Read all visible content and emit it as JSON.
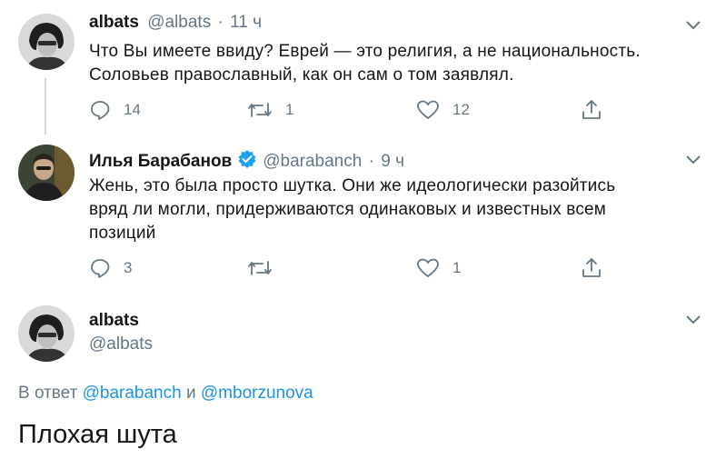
{
  "tweet1": {
    "author_name": "albats",
    "author_handle": "@albats",
    "separator": "·",
    "time": "11 ч",
    "text_line1": "Что Вы имеете ввиду? Еврей — это религия, а не национальность.",
    "text_line2": "Соловьев православный, как он сам о том заявлял.",
    "replies": "14",
    "retweets": "1",
    "likes": "12"
  },
  "tweet2": {
    "author_name": "Илья Барабанов",
    "verified": true,
    "author_handle": "@barabanch",
    "separator": "·",
    "time": "9 ч",
    "text_line1": "Жень, это была просто шутка. Они же идеологически разойтись",
    "text_line2": "вряд ли могли, придерживаются одинаковых и известных всем",
    "text_line3": "позиций",
    "replies": "3",
    "retweets": "",
    "likes": "1"
  },
  "main_tweet": {
    "author_name": "albats",
    "author_handle": "@albats",
    "reply_prefix": "В ответ",
    "reply_to_1": "@barabanch",
    "reply_joiner": "и",
    "reply_to_2": "@mborzunova",
    "text": "Плохая шута"
  },
  "colors": {
    "secondary": "#657786",
    "link": "#1b95e0",
    "verified": "#1da1f2"
  }
}
